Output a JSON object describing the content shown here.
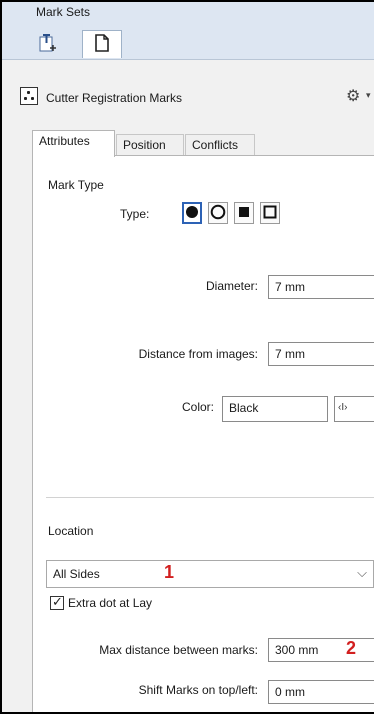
{
  "panel": {
    "title": "Mark Sets"
  },
  "header_row": {
    "label": "Cutter Registration Marks",
    "gear": "⚙",
    "caret": "▾"
  },
  "tabs": [
    {
      "label": "Attributes"
    },
    {
      "label": "Position"
    },
    {
      "label": "Conflicts"
    }
  ],
  "attributes": {
    "mark_type_heading": "Mark Type",
    "type_label": "Type:",
    "diameter_label": "Diameter:",
    "diameter_value": "7 mm",
    "distance_label": "Distance from images:",
    "distance_value": "7 mm",
    "color_label": "Color:",
    "color_value": "Black",
    "color_picker_glyph": "‹I›"
  },
  "location": {
    "heading": "Location",
    "select_value": "All Sides",
    "select_chevron": "⌵",
    "extra_dot_label": "Extra dot at Lay",
    "max_distance_label": "Max distance between marks:",
    "max_distance_value": "300 mm",
    "shift_label": "Shift Marks on top/left:",
    "shift_value": "0 mm"
  },
  "annotations": {
    "one": "1",
    "two": "2"
  },
  "colors": {
    "header_bg": "#dde6f2",
    "selected_border": "#2d62b5",
    "annotation_red": "#d21f1f"
  }
}
